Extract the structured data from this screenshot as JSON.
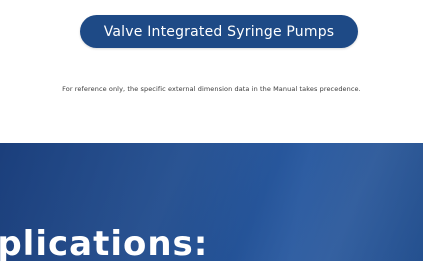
{
  "header": {
    "product_button_label": "Valve Integrated Syringe Pumps",
    "disclaimer": "For reference only, the specific external dimension data in the Manual takes precedence."
  },
  "section": {
    "title_visible": "pplications:"
  },
  "colors": {
    "button_bg": "#1e4a86",
    "band_bg": "#1f4c8f",
    "text_on_dark": "#ffffff"
  }
}
